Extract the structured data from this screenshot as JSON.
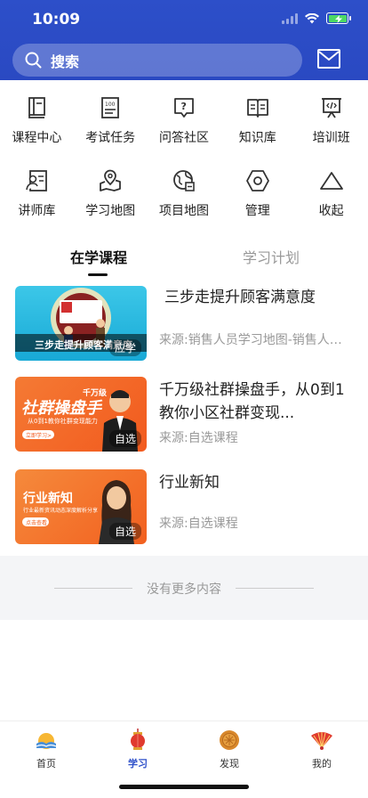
{
  "status": {
    "time": "10:09"
  },
  "search": {
    "placeholder": "搜索"
  },
  "grid": {
    "row1": [
      {
        "label": "课程中心",
        "icon": "book-icon"
      },
      {
        "label": "考试任务",
        "icon": "exam-icon"
      },
      {
        "label": "问答社区",
        "icon": "question-icon"
      },
      {
        "label": "知识库",
        "icon": "open-book-icon"
      },
      {
        "label": "培训班",
        "icon": "presentation-icon"
      }
    ],
    "row2": [
      {
        "label": "讲师库",
        "icon": "lecturer-icon"
      },
      {
        "label": "学习地图",
        "icon": "map-pin-icon"
      },
      {
        "label": "项目地图",
        "icon": "globe-icon"
      },
      {
        "label": "管理",
        "icon": "hexagon-gear-icon"
      },
      {
        "label": "收起",
        "icon": "collapse-triangle-icon"
      }
    ]
  },
  "tabs": {
    "active": "在学课程",
    "inactive": "学习计划"
  },
  "courses": [
    {
      "title": "三步走提升顾客满意度",
      "source": "来源:销售人员学习地图-销售人员学习地图",
      "badge": "应学",
      "thumb_text": "三步走提升顾客满意度"
    },
    {
      "title": "千万级社群操盘手，从0到1教你小区社群变现...",
      "source": "来源:自选课程",
      "badge": "自选",
      "thumb_text": "社群操盘手",
      "thumb_small": "千万级",
      "thumb_sub": "从0到1教你社群变现能力",
      "thumb_btn": "立即学习>"
    },
    {
      "title": "行业新知",
      "source": "来源:自选课程",
      "badge": "自选",
      "thumb_text": "行业新知",
      "thumb_sub": "行业最新资讯动态深度解析分享",
      "thumb_btn": "点击查看"
    }
  ],
  "no_more": "没有更多内容",
  "tabbar": [
    {
      "label": "首页",
      "icon": "home-sunrise-icon",
      "active": false
    },
    {
      "label": "学习",
      "icon": "lantern-icon",
      "active": true
    },
    {
      "label": "发现",
      "icon": "mooncake-icon",
      "active": false
    },
    {
      "label": "我的",
      "icon": "fan-icon",
      "active": false
    }
  ],
  "colors": {
    "header": "#2d4fc9",
    "active_tab": "#2d4fc9",
    "orange": "#f4732a"
  }
}
